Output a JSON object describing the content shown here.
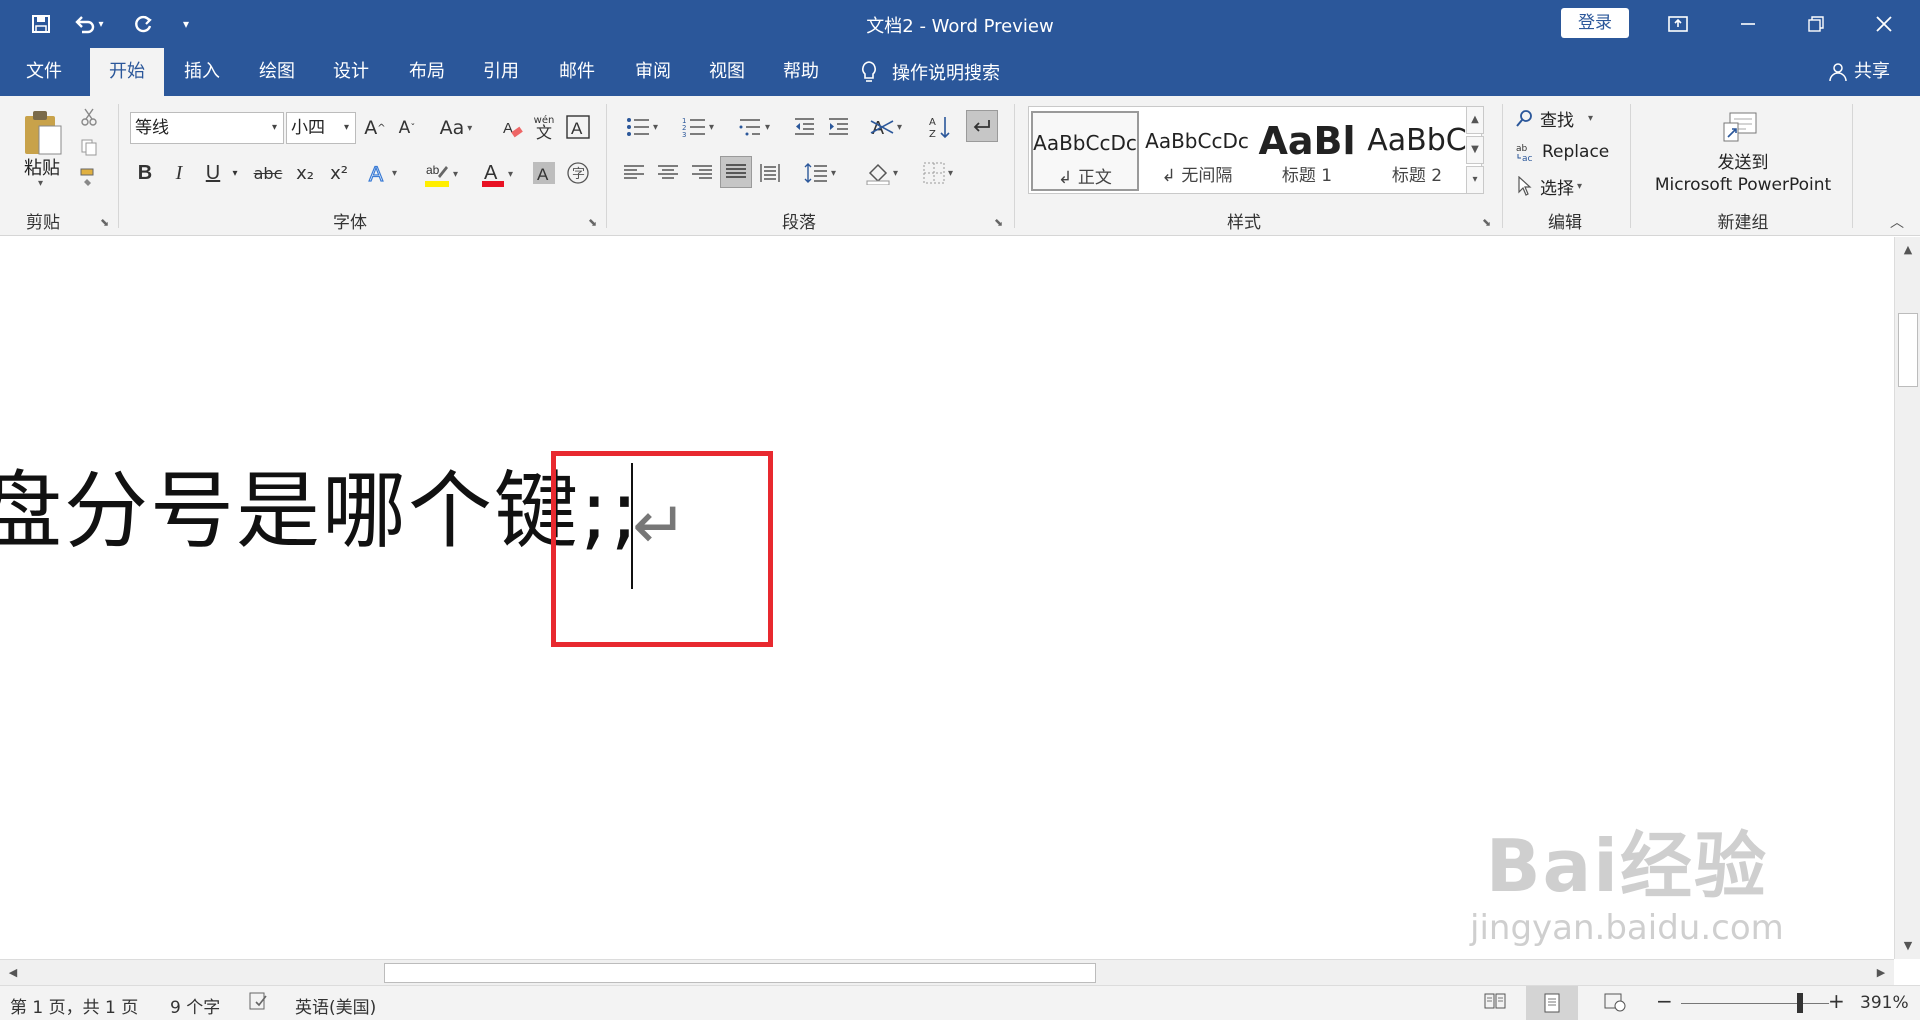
{
  "title_bar": {
    "title": "文档2  -  Word Preview",
    "login_label": "登录",
    "quick_access": [
      "save-icon",
      "undo-icon",
      "redo-icon",
      "customize-icon"
    ]
  },
  "tabs": [
    {
      "label": "文件"
    },
    {
      "label": "开始",
      "active": true
    },
    {
      "label": "插入"
    },
    {
      "label": "绘图"
    },
    {
      "label": "设计"
    },
    {
      "label": "布局"
    },
    {
      "label": "引用"
    },
    {
      "label": "邮件"
    },
    {
      "label": "审阅"
    },
    {
      "label": "视图"
    },
    {
      "label": "帮助"
    }
  ],
  "search": {
    "label": "操作说明搜索"
  },
  "share": {
    "label": "共享"
  },
  "ribbon": {
    "clipboard": {
      "paste_label": "粘贴",
      "group_label": "剪贴板"
    },
    "font": {
      "font_name": "等线",
      "font_size": "小四",
      "change_case_label": "Aa",
      "bold": "B",
      "italic": "I",
      "underline": "U",
      "strikethrough": "abc",
      "subscript": "x₂",
      "superscript": "x²",
      "group_label": "字体"
    },
    "paragraph": {
      "group_label": "段落"
    },
    "styles": {
      "items": [
        {
          "sample": "AaBbCcDc",
          "name": "↲ 正文"
        },
        {
          "sample": "AaBbCcDc",
          "name": "↲ 无间隔"
        },
        {
          "sample": "AaBl",
          "name": "标题 1"
        },
        {
          "sample": "AaBbC",
          "name": "标题 2"
        }
      ],
      "group_label": "样式"
    },
    "editing": {
      "find_label": "查找",
      "replace_label": "Replace",
      "select_label": "选择",
      "group_label": "编辑"
    },
    "new_group": {
      "send_label_line1": "发送到",
      "send_label_line2": "Microsoft PowerPoint",
      "group_label": "新建组"
    }
  },
  "document": {
    "text": "盘分号是哪个键;;",
    "paragraph_mark": "↵"
  },
  "watermark": {
    "big": "Bai经验",
    "small": "jingyan.baidu.com"
  },
  "status_bar": {
    "page_info": "第 1 页，共 1 页",
    "word_count": "9 个字",
    "language": "英语(美国)",
    "zoom_minus": "−",
    "zoom_plus": "+",
    "zoom_level": "391%"
  },
  "colors": {
    "brand_blue": "#2b579a",
    "ribbon_bg": "#f3f3f3",
    "highlight_red": "#e8292f"
  }
}
